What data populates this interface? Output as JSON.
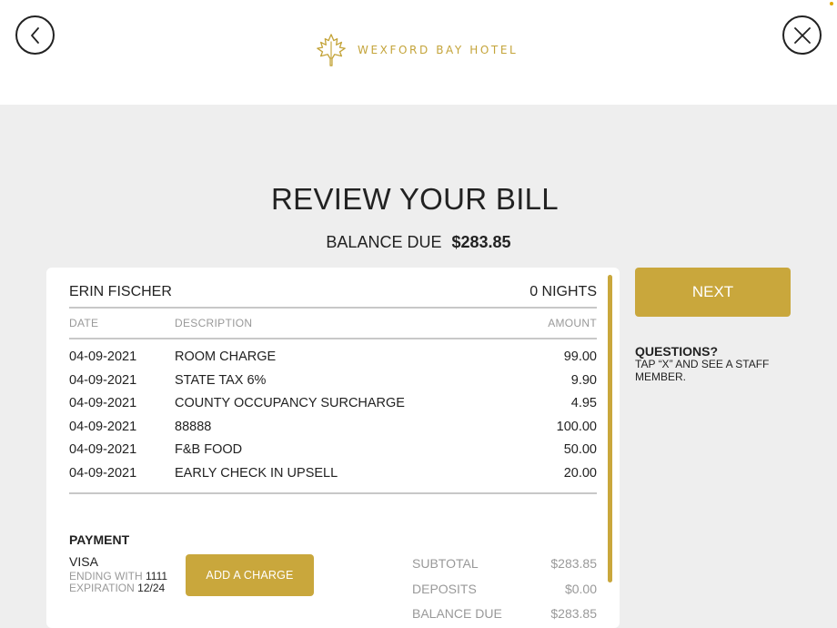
{
  "header": {
    "logo_text": "WEXFORD BAY HOTEL",
    "back_icon": "chevron-left-icon",
    "close_icon": "close-icon",
    "logo_icon": "maple-leaf-icon"
  },
  "page": {
    "title": "REVIEW YOUR BILL",
    "balance_label": "BALANCE DUE",
    "balance_value": "$283.85"
  },
  "bill": {
    "guest_name": "ERIN FISCHER",
    "nights": "0 NIGHTS",
    "columns": {
      "date": "DATE",
      "description": "DESCRIPTION",
      "amount": "AMOUNT"
    },
    "items": [
      {
        "date": "04-09-2021",
        "description": "ROOM CHARGE",
        "amount": "99.00"
      },
      {
        "date": "04-09-2021",
        "description": "STATE TAX 6%",
        "amount": "9.90"
      },
      {
        "date": "04-09-2021",
        "description": "COUNTY OCCUPANCY SURCHARGE",
        "amount": "4.95"
      },
      {
        "date": "04-09-2021",
        "description": "88888",
        "amount": "100.00"
      },
      {
        "date": "04-09-2021",
        "description": "F&B FOOD",
        "amount": "50.00"
      },
      {
        "date": "04-09-2021",
        "description": "EARLY CHECK IN UPSELL",
        "amount": "20.00"
      }
    ],
    "payment": {
      "title": "PAYMENT",
      "method": "VISA",
      "ending_label": "ENDING WITH",
      "ending_value": "1111",
      "expiration_label": "EXPIRATION",
      "expiration_value": "12/24",
      "add_charge_label": "ADD A CHARGE"
    },
    "totals": [
      {
        "label": "SUBTOTAL",
        "value": "$283.85"
      },
      {
        "label": "DEPOSITS",
        "value": "$0.00"
      },
      {
        "label": "BALANCE DUE",
        "value": "$283.85"
      }
    ]
  },
  "sidebar": {
    "next_label": "NEXT",
    "questions_title": "QUESTIONS?",
    "questions_text": "TAP “X” AND SEE A STAFF MEMBER."
  },
  "colors": {
    "accent_gold": "#c9a73c",
    "background": "#eeeeee",
    "card": "#ffffff",
    "muted_text": "#999999"
  }
}
